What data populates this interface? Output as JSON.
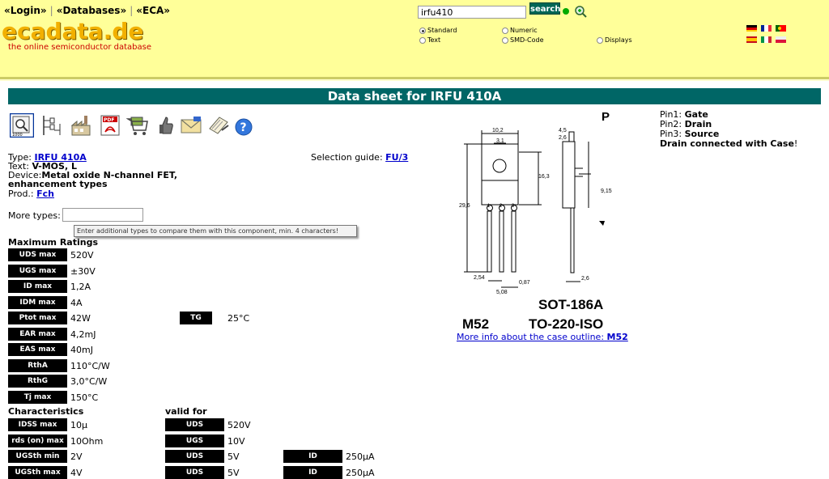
{
  "nav": {
    "login": "«Login»",
    "databases": "«Databases»",
    "eca": "«ECA»"
  },
  "logo": {
    "text": "ecadata.de",
    "tagline": "the online semiconductor database"
  },
  "search": {
    "value": "irfu410",
    "button": "search",
    "options": [
      "Standard",
      "Numeric",
      "Text",
      "SMD-Code",
      "Displays"
    ],
    "selected": "Standard"
  },
  "flags": [
    "de",
    "fr",
    "pt",
    "es",
    "it",
    "pl"
  ],
  "page_title": "Data sheet for IRFU 410A",
  "toolbar_icons": [
    "datasheet-icon",
    "circuit-icon",
    "factory-icon",
    "pdf-icon",
    "cart-icon",
    "thumbs-up-icon",
    "mail-icon",
    "notepad-icon",
    "help-icon"
  ],
  "info": {
    "type_label": "Type:",
    "type_value": "IRFU 410A",
    "text_label": "Text:",
    "text_value": "V-MOS, L",
    "device_label": "Device:",
    "device_value_1": "Metal oxide N-channel FET,",
    "device_value_2": "enhancement types",
    "prod_label": "Prod.:",
    "prod_value": "Fch",
    "selection_label": "Selection guide:",
    "selection_value": "FU/3",
    "more_types_label": "More types:",
    "tooltip": "Enter additional types to compare them with this component, min. 4 characters!"
  },
  "max_ratings": {
    "heading": "Maximum Ratings",
    "rows": [
      {
        "param": "UDS max",
        "value": "520V"
      },
      {
        "param": "UGS max",
        "value": "±30V"
      },
      {
        "param": "ID max",
        "value": "1,2A"
      },
      {
        "param": "IDM max",
        "value": "4A"
      },
      {
        "param": "Ptot max",
        "value": "42W"
      },
      {
        "param": "EAR max",
        "value": "4,2mJ"
      },
      {
        "param": "EAS max",
        "value": "40mJ"
      },
      {
        "param": "RthA",
        "value": "110°C/W"
      },
      {
        "param": "RthG",
        "value": "3,0°C/W"
      },
      {
        "param": "Tj max",
        "value": "150°C"
      }
    ],
    "tg_param": "TG",
    "tg_value": "25°C"
  },
  "characteristics": {
    "heading": "Characteristics",
    "valid_heading": "valid for",
    "rows": [
      {
        "param": "IDSS max",
        "value": "10µ",
        "c1": "UDS",
        "v1": "520V",
        "c2": "",
        "v2": ""
      },
      {
        "param": "rds (on) max",
        "value": "10Ohm",
        "c1": "UGS",
        "v1": "10V",
        "c2": "",
        "v2": ""
      },
      {
        "param": "UGSth min",
        "value": "2V",
        "c1": "UDS",
        "v1": "5V",
        "c2": "ID",
        "v2": "250µA"
      },
      {
        "param": "UGSth max",
        "value": "4V",
        "c1": "UDS",
        "v1": "5V",
        "c2": "ID",
        "v2": "250µA"
      }
    ]
  },
  "package": {
    "corner": "P",
    "code": "M52",
    "name1": "SOT-186A",
    "name2": "TO-220-ISO",
    "dims": [
      "10,2",
      "3,1",
      "16,3",
      "29,6",
      "9,15",
      "4,5",
      "2,6",
      "2,54",
      "0,87",
      "5,08",
      "2,6"
    ],
    "pin_numbers": [
      "1",
      "2",
      "3"
    ],
    "more_info_text": "More info about the case outline:",
    "more_info_link": "M52"
  },
  "pins": {
    "pin1_label": "Pin1:",
    "pin1": "Gate",
    "pin2_label": "Pin2:",
    "pin2": "Drain",
    "pin3_label": "Pin3:",
    "pin3": "Source",
    "note": "Drain connected with Case",
    "note_end": "!"
  }
}
